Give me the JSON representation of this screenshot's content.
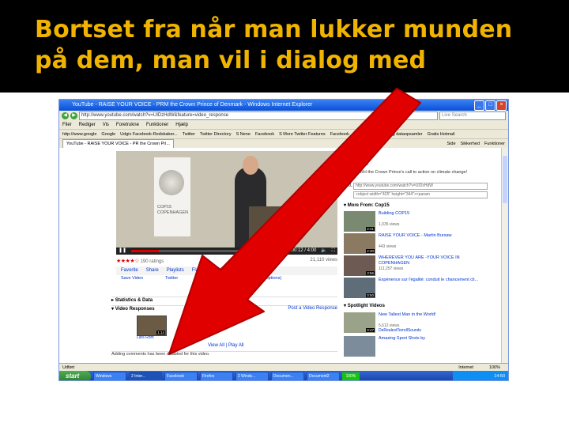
{
  "slide": {
    "title_line1": "Bortset fra når man lukker munden",
    "title_line2": "på dem, man vil i dialog med"
  },
  "browser": {
    "window_title": "YouTube - RAISE YOUR VOICE - PRM the Crown Prince of Denmark - Windows Internet Explorer",
    "address": "http://www.youtube.com/watch?v=UIDzHdW&feature=video_response",
    "search_placeholder": "Live Search",
    "menu": [
      "Filer",
      "Rediger",
      "Vis",
      "Foretrukne",
      "Funktioner",
      "Hjælp"
    ],
    "favorites": [
      "http://www.google",
      "Google",
      "Udgiv Facebook-Redskaber...",
      "Twitter",
      "Twitter Directory",
      "S Nene",
      "Facebook",
      "S More Twitter Features",
      "Facebook",
      "Personlig",
      "Personlig dataopsamler",
      "Gratis Hotmail"
    ],
    "tab_label": "YouTube - RAISE YOUR VOICE - PR the Crown Pri...",
    "tab_tools": [
      "Side",
      "Sikkerhed",
      "Funktioner"
    ],
    "status_left": "Udført",
    "status_zone": "Internet",
    "status_zoom": "100%"
  },
  "video": {
    "banner_text": "COP15 COPENHAGEN",
    "time": "00:12 / 4:00",
    "stars": "★★★★☆",
    "ratings": "190 ratings",
    "views": "21,110 views",
    "actions": [
      "Favorite",
      "Share",
      "Playlists",
      "Flag"
    ],
    "sub_actions": [
      "Save Video",
      "Twitter",
      "Facebook",
      "(more share options)"
    ],
    "sec_stats": "Statistics & Data",
    "sec_resp": "Video Responses",
    "sec_resp_link": "Post a Video Response",
    "resp_label": "Lars Rom",
    "resp_time": "1:14",
    "view_all": "View All",
    "play_all": "Play All",
    "disabled_msg": "Adding comments has been disabled for this video."
  },
  "sidebar": {
    "date": "2009",
    "from": "From: cop15",
    "info1": "Watch HRH the Crown Prince's call to action on climate change!",
    "url_label": "URL",
    "url_value": "http://www.youtube.com/watch?v=UIDzHdW",
    "embed": "<object width=\"425\" height=\"344\"><param",
    "more_from": "More From: Cop15",
    "more_items": [
      {
        "title": "Building COP15",
        "views": "1,035 views",
        "time": "2:41"
      },
      {
        "title": "RAISE YOUR VOICE - Martin Bursaw",
        "views": "443 views",
        "time": "2:30"
      },
      {
        "title": "WHEREVER YOU ARE -YOUR VOICE IN COPENHAGEN",
        "views": "111,257 views",
        "time": "3:56"
      },
      {
        "title": "Expérience sur l'égalité: conduit le chancement cli...",
        "views": "",
        "time": "0:50"
      }
    ],
    "spotlight": "Spotlight Videos",
    "spot_items": [
      {
        "title": "New Tallest Man in the World!",
        "views": "5,612 views",
        "time": "0:47",
        "user": "DeRealestTerrellSounds"
      },
      {
        "title": "Amazing Sport Shots by",
        "views": "",
        "time": "",
        "user": ""
      }
    ]
  },
  "taskbar": {
    "start": "start",
    "tasks": [
      "Windows",
      "2 Inter...",
      "Facebook",
      "Firefox",
      "2 Winds...",
      "Documen...",
      "Document2"
    ],
    "progress": "100%",
    "clock": "14:50"
  },
  "colors": {
    "title": "#f0b400",
    "arrow": "#e00000"
  }
}
